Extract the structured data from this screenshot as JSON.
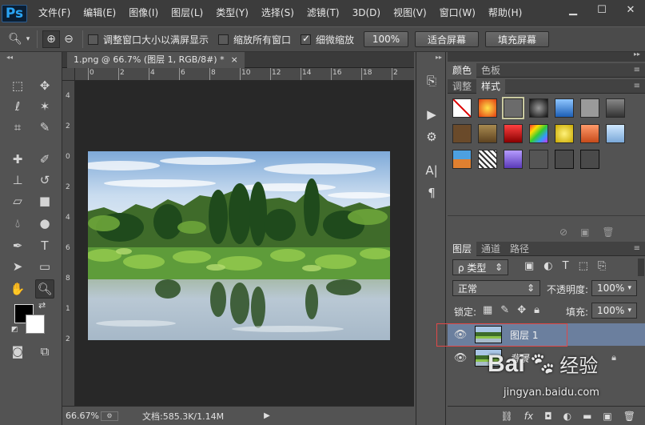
{
  "menubar": {
    "logo": "Ps",
    "items": [
      "文件(F)",
      "编辑(E)",
      "图像(I)",
      "图层(L)",
      "类型(Y)",
      "选择(S)",
      "滤镜(T)",
      "3D(D)",
      "视图(V)",
      "窗口(W)",
      "帮助(H)"
    ]
  },
  "options": {
    "resize_windows_label": "调整窗口大小以满屏显示",
    "zoom_all_label": "缩放所有窗口",
    "scrubby_zoom_label": "细微缩放",
    "btn_100": "100%",
    "btn_fit": "适合屏幕",
    "btn_fill": "填充屏幕"
  },
  "document": {
    "tab_title": "1.png @ 66.7% (图层 1, RGB/8#) *",
    "tab_close": "×",
    "hruler_labels": [
      "0",
      "2",
      "4",
      "6",
      "8",
      "10",
      "12",
      "14",
      "16",
      "18",
      "2"
    ],
    "vruler_labels": [
      "4",
      "2",
      "0",
      "2",
      "4",
      "6",
      "8",
      "1",
      "2"
    ],
    "status": {
      "zoom": "66.67%",
      "doc_info": "文档:585.3K/1.14M"
    }
  },
  "panels": {
    "color_tabs": [
      "颜色",
      "色板"
    ],
    "style_tabs": [
      "调整",
      "样式"
    ],
    "layers_tabs": [
      "图层",
      "通道",
      "路径"
    ],
    "kind_filter": "ρ 类型",
    "blend_mode": "正常",
    "opacity_label": "不透明度:",
    "opacity_value": "100%",
    "lock_label": "锁定:",
    "fill_label": "填充:",
    "fill_value": "100%",
    "layers": [
      {
        "name": "图层 1",
        "selected": true
      },
      {
        "name": "背景",
        "selected": false
      }
    ]
  },
  "watermark": {
    "text1": "Bai",
    "text2": "经验",
    "url": "jingyan.baidu.com"
  },
  "colors": {
    "selected_layer": "#6b7f9e",
    "highlight_box": "#e04848"
  }
}
